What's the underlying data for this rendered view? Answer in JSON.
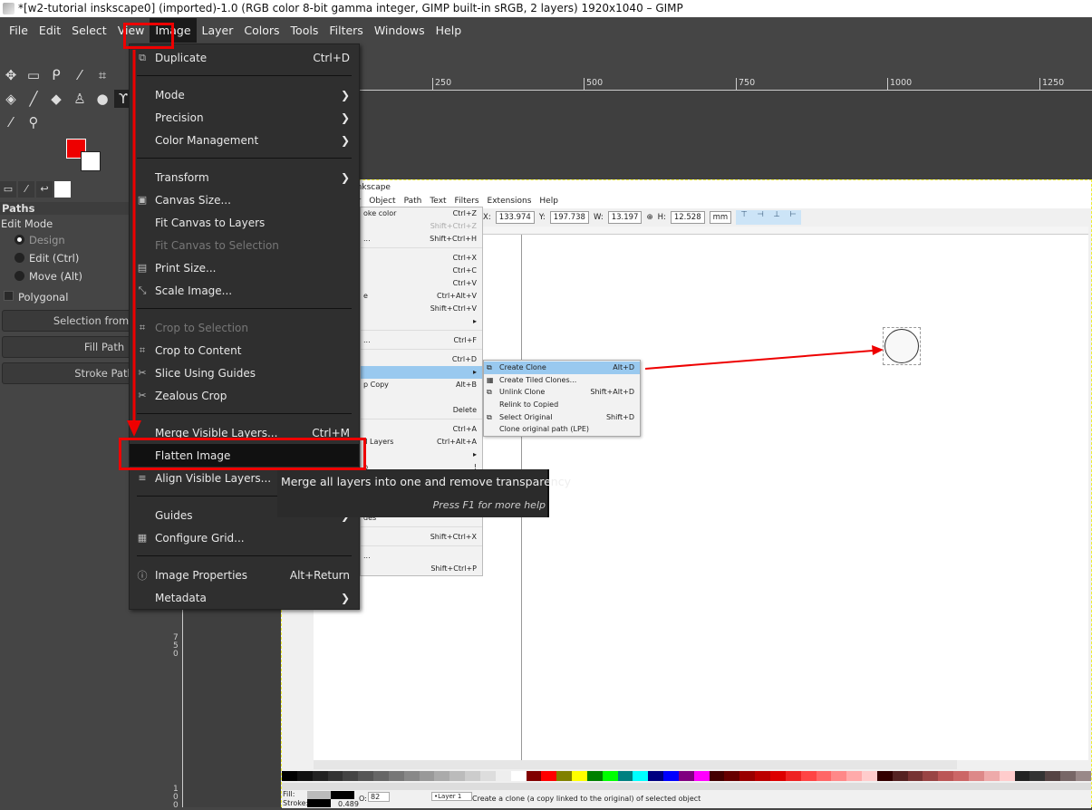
{
  "window": {
    "title": "*[w2-tutorial inskscape0] (imported)-1.0 (RGB color 8-bit gamma integer, GIMP built-in sRGB, 2 layers) 1920x1040 – GIMP"
  },
  "menubar": [
    "File",
    "Edit",
    "Select",
    "View",
    "Image",
    "Layer",
    "Colors",
    "Tools",
    "Filters",
    "Windows",
    "Help"
  ],
  "colors": {
    "accent": "#e00000",
    "fg": "#ee0000",
    "bg": "#ffffff"
  },
  "tool_options": {
    "header": "Paths",
    "edit_mode": "Edit Mode",
    "modes": [
      "Design",
      "Edit (Ctrl)",
      "Move (Alt)"
    ],
    "selected_mode": "Design",
    "polygonal": "Polygonal",
    "buttons": [
      "Selection from Path",
      "Fill Path",
      "Stroke Path"
    ]
  },
  "rulers": {
    "top": [
      "250",
      "500",
      "750",
      "1000",
      "1250"
    ],
    "left": [
      "750",
      "100"
    ]
  },
  "image_menu": [
    {
      "label": "Duplicate",
      "shortcut": "Ctrl+D",
      "icon": "duplicate-icon"
    },
    {
      "sep": true
    },
    {
      "label": "Mode",
      "submenu": true
    },
    {
      "label": "Precision",
      "submenu": true
    },
    {
      "label": "Color Management",
      "submenu": true
    },
    {
      "sep": true
    },
    {
      "label": "Transform",
      "submenu": true
    },
    {
      "label": "Canvas Size...",
      "icon": "canvas-size-icon"
    },
    {
      "label": "Fit Canvas to Layers"
    },
    {
      "label": "Fit Canvas to Selection",
      "disabled": true
    },
    {
      "label": "Print Size...",
      "icon": "print-icon"
    },
    {
      "label": "Scale Image...",
      "icon": "scale-icon"
    },
    {
      "sep": true
    },
    {
      "label": "Crop to Selection",
      "disabled": true,
      "icon": "crop-icon"
    },
    {
      "label": "Crop to Content",
      "icon": "crop-icon"
    },
    {
      "label": "Slice Using Guides",
      "icon": "slice-icon"
    },
    {
      "label": "Zealous Crop",
      "icon": "zealous-icon"
    },
    {
      "sep": true
    },
    {
      "label": "Merge Visible Layers...",
      "shortcut": "Ctrl+M"
    },
    {
      "label": "Flatten Image",
      "highlighted": true
    },
    {
      "label": "Align Visible Layers...",
      "icon": "align-icon"
    },
    {
      "sep": true
    },
    {
      "label": "Guides",
      "submenu": true
    },
    {
      "label": "Configure Grid...",
      "icon": "grid-icon"
    },
    {
      "sep": true
    },
    {
      "label": "Image Properties",
      "shortcut": "Alt+Return",
      "icon": "info-icon"
    },
    {
      "label": "Metadata",
      "submenu": true
    }
  ],
  "tooltip": {
    "text": "Merge all layers into one and remove transparency",
    "hint": "Press F1 for more help"
  },
  "inkscape": {
    "title": "Inkscape",
    "menu": [
      "er",
      "Object",
      "Path",
      "Text",
      "Filters",
      "Extensions",
      "Help"
    ],
    "toolbar": {
      "x_label": "X:",
      "x": "133.974",
      "y_label": "Y:",
      "y": "197.738",
      "w_label": "W:",
      "w": "13.197",
      "h_label": "H:",
      "h": "12.528",
      "unit": "mm"
    },
    "edit_menu": [
      {
        "label": "oke color",
        "shortcut": "Ctrl+Z"
      },
      {
        "label": "",
        "shortcut": "Shift+Ctrl+Z",
        "disabled": true
      },
      {
        "label": "...",
        "shortcut": "Shift+Ctrl+H"
      },
      {
        "sep": true
      },
      {
        "label": "",
        "shortcut": "Ctrl+X"
      },
      {
        "label": "",
        "shortcut": "Ctrl+C"
      },
      {
        "label": "",
        "shortcut": "Ctrl+V"
      },
      {
        "label": "e",
        "shortcut": "Ctrl+Alt+V"
      },
      {
        "label": "",
        "shortcut": "Shift+Ctrl+V"
      },
      {
        "label": "",
        "shortcut": "▸"
      },
      {
        "sep": true
      },
      {
        "label": "...",
        "shortcut": "Ctrl+F"
      },
      {
        "sep": true
      },
      {
        "label": "",
        "shortcut": "Ctrl+D"
      },
      {
        "label": "",
        "shortcut": "▸",
        "highlighted": true
      },
      {
        "label": "p Copy",
        "shortcut": "Alt+B"
      },
      {
        "label": "",
        "shortcut": ""
      },
      {
        "label": "",
        "shortcut": "Delete"
      },
      {
        "sep": true
      },
      {
        "label": "",
        "shortcut": "Ctrl+A"
      },
      {
        "label": "ll Layers",
        "shortcut": "Ctrl+Alt+A"
      },
      {
        "label": "",
        "shortcut": "▸"
      },
      {
        "label": "p",
        "shortcut": "!"
      },
      {
        "label": "",
        "shortcut": ""
      },
      {
        "label": "",
        "shortcut": ""
      },
      {
        "label": "",
        "shortcut": ""
      },
      {
        "label": "des",
        "shortcut": ""
      },
      {
        "sep": true
      },
      {
        "label": "",
        "shortcut": "Shift+Ctrl+X"
      },
      {
        "sep": true
      },
      {
        "label": "...",
        "shortcut": ""
      },
      {
        "label": "",
        "shortcut": "Shift+Ctrl+P"
      }
    ],
    "clone_menu": [
      {
        "label": "Create Clone",
        "shortcut": "Alt+D",
        "highlighted": true,
        "icon": "clone-icon"
      },
      {
        "label": "Create Tiled Clones...",
        "shortcut": "",
        "icon": "tiled-clones-icon"
      },
      {
        "label": "Unlink Clone",
        "shortcut": "Shift+Alt+D",
        "icon": "unlink-icon"
      },
      {
        "label": "Relink to Copied",
        "shortcut": ""
      },
      {
        "label": "Select Original",
        "shortcut": "Shift+D",
        "icon": "select-original-icon"
      },
      {
        "label": "Clone original path (LPE)",
        "shortcut": ""
      }
    ],
    "palette": [
      "#000",
      "#111",
      "#222",
      "#333",
      "#444",
      "#555",
      "#666",
      "#777",
      "#888",
      "#999",
      "#aaa",
      "#bbb",
      "#ccc",
      "#ddd",
      "#eee",
      "#fff",
      "#800000",
      "#ff0000",
      "#808000",
      "#ffff00",
      "#008000",
      "#00ff00",
      "#008080",
      "#00ffff",
      "#000080",
      "#0000ff",
      "#800080",
      "#ff00ff",
      "#400",
      "#600",
      "#900",
      "#b00",
      "#d00",
      "#e22",
      "#f44",
      "#f66",
      "#f88",
      "#faa",
      "#fcc",
      "#300",
      "#522",
      "#733",
      "#944",
      "#b55",
      "#c66",
      "#d88",
      "#eaa",
      "#fcc",
      "#222",
      "#333",
      "#544",
      "#766",
      "#988"
    ],
    "status": {
      "fill": "Fill:",
      "stroke": "Stroke:",
      "stroke_width": "0.489",
      "opacity_label": "O:",
      "opacity": "82",
      "layer": "•Layer 1",
      "message": "Create a clone (a copy linked to the original) of selected object"
    }
  }
}
